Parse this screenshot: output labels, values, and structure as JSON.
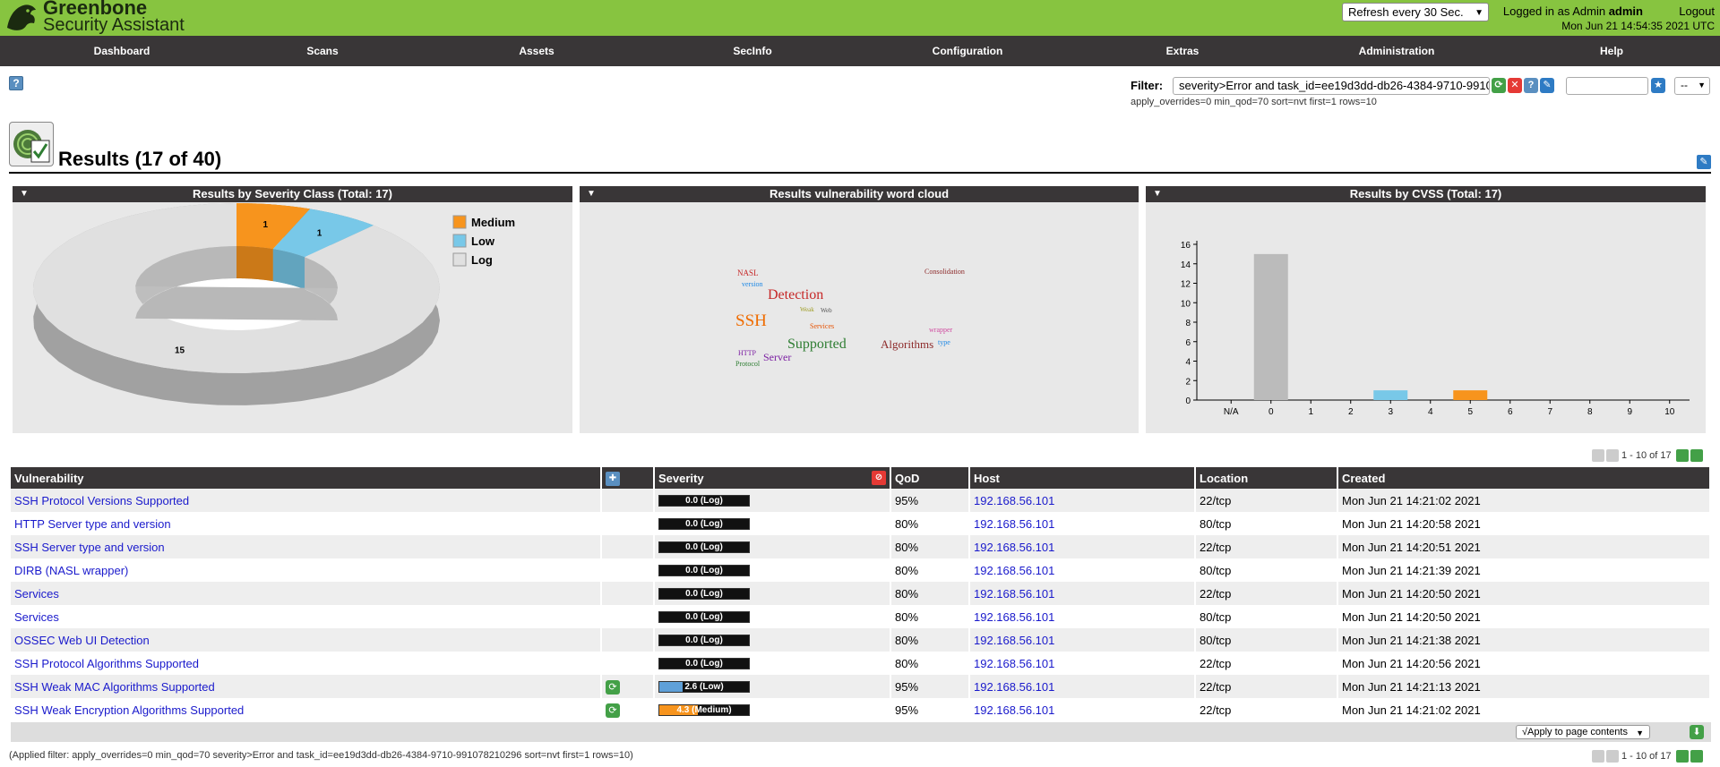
{
  "header": {
    "brand_line1": "Greenbone",
    "brand_line2": "Security Assistant",
    "refresh_label": "Refresh every 30 Sec.",
    "logged_in_prefix": "Logged in as  Admin ",
    "user": "admin",
    "logout": "Logout",
    "datetime": "Mon Jun 21 14:54:35 2021 UTC"
  },
  "nav": {
    "items": [
      "Dashboard",
      "Scans",
      "Assets",
      "SecInfo",
      "Configuration",
      "Extras",
      "Administration",
      "Help"
    ]
  },
  "filter": {
    "label": "Filter:",
    "value": "severity>Error and task_id=ee19d3dd-db26-4384-9710-991078210296",
    "params": "apply_overrides=0 min_qod=70 sort=nvt first=1 rows=10",
    "select_value": "--"
  },
  "page": {
    "title": "Results (17 of 40)"
  },
  "panels": {
    "severity_title": "Results by Severity Class (Total: 17)",
    "wordcloud_title": "Results vulnerability word cloud",
    "cvss_title": "Results by CVSS (Total: 17)"
  },
  "chart_data": [
    {
      "type": "pie",
      "title": "Results by Severity Class (Total: 17)",
      "categories": [
        "Medium",
        "Low",
        "Log"
      ],
      "values": [
        1,
        1,
        15
      ],
      "colors": [
        "#f7941d",
        "#78c8e8",
        "#e0e0e0"
      ],
      "legend": "top-right"
    },
    {
      "type": "bar",
      "title": "Results by CVSS (Total: 17)",
      "categories": [
        "N/A",
        "0",
        "1",
        "2",
        "3",
        "4",
        "5",
        "6",
        "7",
        "8",
        "9",
        "10"
      ],
      "values": [
        0,
        15,
        0,
        0,
        1,
        0,
        1,
        0,
        0,
        0,
        0,
        0
      ],
      "colors": [
        "#bbbbbb",
        "#bbbbbb",
        "#bbbbbb",
        "#bbbbbb",
        "#78c8e8",
        "#78c8e8",
        "#f7941d",
        "#f7941d",
        "#e53935",
        "#e53935",
        "#e53935",
        "#e53935"
      ],
      "ylim": [
        0,
        16
      ],
      "yticks": [
        0,
        2,
        4,
        6,
        8,
        10,
        12,
        14,
        16
      ]
    }
  ],
  "wordcloud": [
    {
      "text": "NASL",
      "color": "#c62828"
    },
    {
      "text": "version",
      "color": "#1e88e5"
    },
    {
      "text": "Detection",
      "color": "#c62828"
    },
    {
      "text": "Consolidation",
      "color": "#8d2a2a"
    },
    {
      "text": "Weak",
      "color": "#9e9d24"
    },
    {
      "text": "Web",
      "color": "#555555"
    },
    {
      "text": "SSH",
      "color": "#ef6c00"
    },
    {
      "text": "Services",
      "color": "#e65100"
    },
    {
      "text": "wrapper",
      "color": "#d04ba0"
    },
    {
      "text": "Supported",
      "color": "#2e7d32"
    },
    {
      "text": "Algorithms",
      "color": "#8d2a2a"
    },
    {
      "text": "type",
      "color": "#1e88e5"
    },
    {
      "text": "HTTP",
      "color": "#7b1fa2"
    },
    {
      "text": "Server",
      "color": "#7b1fa2"
    },
    {
      "text": "Protocol",
      "color": "#2e7d32"
    }
  ],
  "pager": {
    "text": "1 - 10 of 17"
  },
  "table": {
    "columns": [
      "Vulnerability",
      "",
      "Severity",
      "QoD",
      "Host",
      "Location",
      "Created"
    ],
    "rows": [
      {
        "vuln": "SSH Protocol Versions Supported",
        "override": false,
        "severity": "0.0 (Log)",
        "sev": 0.0,
        "qod": "95%",
        "host": "192.168.56.101",
        "location": "22/tcp",
        "created": "Mon Jun 21 14:21:02 2021"
      },
      {
        "vuln": "HTTP Server type and version",
        "override": false,
        "severity": "0.0 (Log)",
        "sev": 0.0,
        "qod": "80%",
        "host": "192.168.56.101",
        "location": "80/tcp",
        "created": "Mon Jun 21 14:20:58 2021"
      },
      {
        "vuln": "SSH Server type and version",
        "override": false,
        "severity": "0.0 (Log)",
        "sev": 0.0,
        "qod": "80%",
        "host": "192.168.56.101",
        "location": "22/tcp",
        "created": "Mon Jun 21 14:20:51 2021"
      },
      {
        "vuln": "DIRB (NASL wrapper)",
        "override": false,
        "severity": "0.0 (Log)",
        "sev": 0.0,
        "qod": "80%",
        "host": "192.168.56.101",
        "location": "80/tcp",
        "created": "Mon Jun 21 14:21:39 2021"
      },
      {
        "vuln": "Services",
        "override": false,
        "severity": "0.0 (Log)",
        "sev": 0.0,
        "qod": "80%",
        "host": "192.168.56.101",
        "location": "22/tcp",
        "created": "Mon Jun 21 14:20:50 2021"
      },
      {
        "vuln": "Services",
        "override": false,
        "severity": "0.0 (Log)",
        "sev": 0.0,
        "qod": "80%",
        "host": "192.168.56.101",
        "location": "80/tcp",
        "created": "Mon Jun 21 14:20:50 2021"
      },
      {
        "vuln": "OSSEC Web UI Detection",
        "override": false,
        "severity": "0.0 (Log)",
        "sev": 0.0,
        "qod": "80%",
        "host": "192.168.56.101",
        "location": "80/tcp",
        "created": "Mon Jun 21 14:21:38 2021"
      },
      {
        "vuln": "SSH Protocol Algorithms Supported",
        "override": false,
        "severity": "0.0 (Log)",
        "sev": 0.0,
        "qod": "80%",
        "host": "192.168.56.101",
        "location": "22/tcp",
        "created": "Mon Jun 21 14:20:56 2021"
      },
      {
        "vuln": "SSH Weak MAC Algorithms Supported",
        "override": true,
        "severity": "2.6 (Low)",
        "sev": 2.6,
        "qod": "95%",
        "host": "192.168.56.101",
        "location": "22/tcp",
        "created": "Mon Jun 21 14:21:13 2021"
      },
      {
        "vuln": "SSH Weak Encryption Algorithms Supported",
        "override": true,
        "severity": "4.3 (Medium)",
        "sev": 4.3,
        "qod": "95%",
        "host": "192.168.56.101",
        "location": "22/tcp",
        "created": "Mon Jun 21 14:21:02 2021"
      }
    ]
  },
  "footer": {
    "apply_label": "√Apply to page contents",
    "applied_filter": "(Applied filter: apply_overrides=0 min_qod=70 severity>Error and task_id=ee19d3dd-db26-4384-9710-991078210296 sort=nvt first=1 rows=10)"
  },
  "colors": {
    "header_green": "#87c440",
    "nav_dark": "#393637",
    "medium": "#f7941d",
    "low": "#78c8e8",
    "log": "#e0e0e0",
    "link": "#1a1acc"
  }
}
